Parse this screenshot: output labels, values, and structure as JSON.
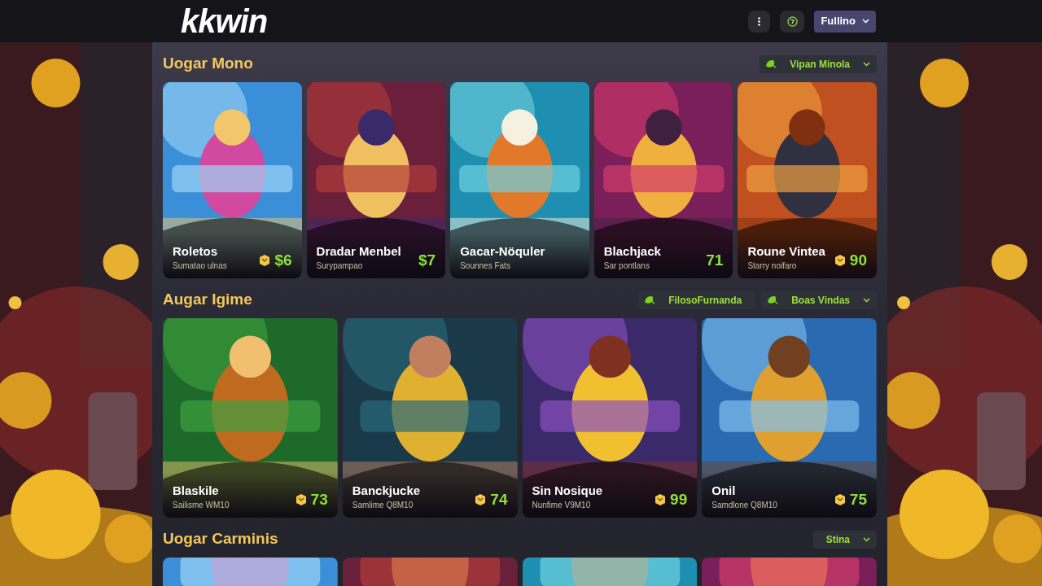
{
  "header": {
    "logo": "kkwin",
    "user_menu": "Fullino"
  },
  "sections": [
    {
      "title": "Uogar Mono",
      "filters": [
        {
          "label": "Vipan Minola",
          "icon": true,
          "caret": true
        }
      ],
      "games": [
        {
          "name": "Roletos",
          "subtitle": "Sumatao ulnas",
          "value": "$6",
          "coin_icon": true
        },
        {
          "name": "Dradar Menbel",
          "subtitle": "Surypampao",
          "value": "$7",
          "coin_icon": false
        },
        {
          "name": "Gacar-Nöquler",
          "subtitle": "Sounnes Fats",
          "coin_icon": false
        },
        {
          "name": "Blachjack",
          "subtitle": "Sar pontlans",
          "value": "71",
          "coin_icon": false
        },
        {
          "name": "Roune Vintea",
          "subtitle": "Starry noifaro",
          "value": "90",
          "coin_icon": true
        }
      ]
    },
    {
      "title": "Augar Igime",
      "filters": [
        {
          "label": "FilosoFurnanda",
          "icon": true,
          "caret": false
        },
        {
          "label": "Boas Vindas",
          "icon": true,
          "caret": true
        }
      ],
      "games": [
        {
          "name": "Blaskile",
          "subtitle": "Sailisme WM10",
          "value": "73",
          "coin_icon": true
        },
        {
          "name": "Banckjucke",
          "subtitle": "Samlime Q8M10",
          "value": "74",
          "coin_icon": true
        },
        {
          "name": "Sin Nosique",
          "subtitle": "Nunfime V9M10",
          "value": "99",
          "coin_icon": true
        },
        {
          "name": "Onil",
          "subtitle": "Samdlone Q8M10",
          "value": "75",
          "coin_icon": true
        }
      ]
    },
    {
      "title": "Uogar Carminis",
      "filters": [
        {
          "label": "Stina",
          "icon": false,
          "caret": true
        }
      ],
      "games": [
        {
          "kind": "picture"
        },
        {
          "kind": "picture"
        },
        {
          "kind": "picture"
        },
        {
          "kind": "picture"
        }
      ]
    }
  ]
}
